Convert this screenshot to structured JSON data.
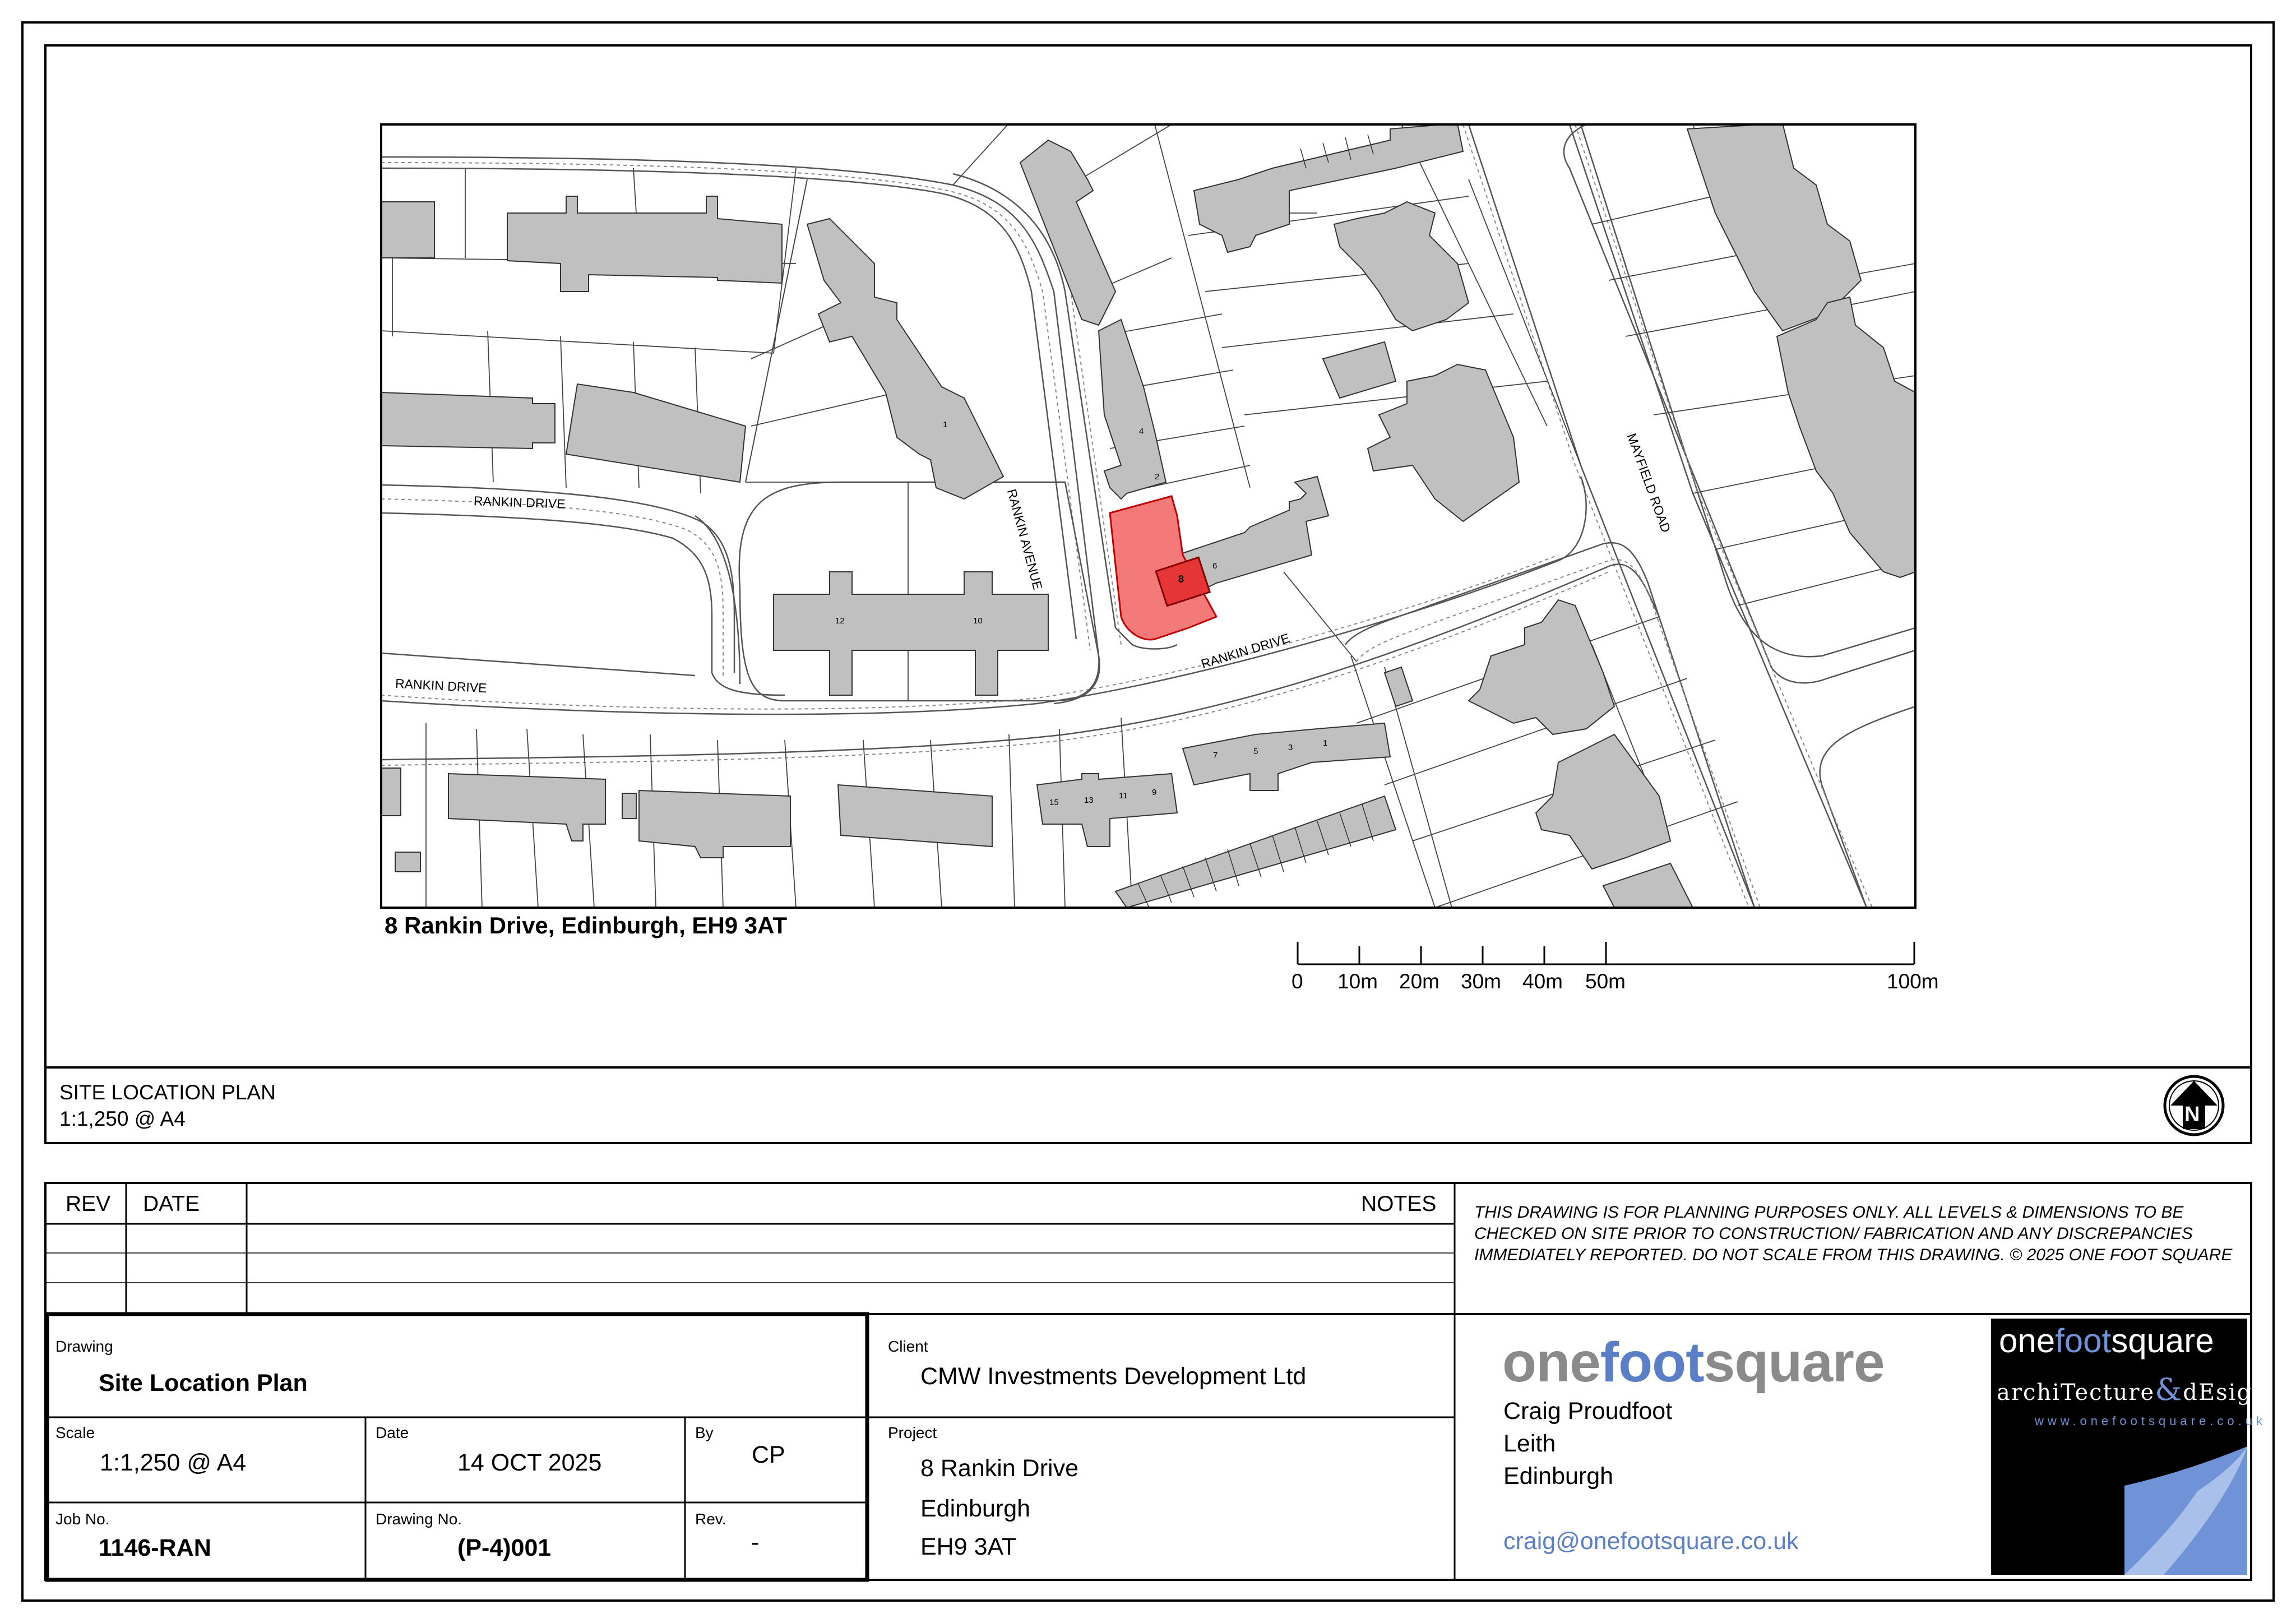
{
  "map": {
    "street_labels": [
      "RANKIN DRIVE",
      "RANKIN DRIVE",
      "RANKIN DRIVE",
      "RANKIN AVENUE",
      "MAYFIELD ROAD"
    ],
    "house_numbers": [
      "1",
      "2",
      "4",
      "6",
      "8",
      "10",
      "12",
      "15",
      "13",
      "11",
      "9",
      "7",
      "5",
      "3",
      "1"
    ],
    "site_color": "#f47a7a",
    "site_building_color": "#e53535",
    "building_color": "#c0c0c0"
  },
  "address_caption": "8 Rankin Drive, Edinburgh, EH9 3AT",
  "scale_bar": {
    "labels": [
      "0",
      "10m",
      "20m",
      "30m",
      "40m",
      "50m",
      "100m"
    ]
  },
  "plan_title": {
    "name": "SITE LOCATION PLAN",
    "scale": "1:1,250 @ A4"
  },
  "north_arrow": {
    "letter": "N"
  },
  "revisions": {
    "headers": {
      "rev": "REV",
      "date": "DATE",
      "notes": "NOTES"
    },
    "disclaimer": "THIS DRAWING IS FOR PLANNING PURPOSES ONLY. ALL LEVELS & DIMENSIONS TO BE CHECKED ON SITE PRIOR TO CONSTRUCTION/ FABRICATION AND ANY DISCREPANCIES IMMEDIATELY REPORTED. DO NOT SCALE FROM THIS DRAWING. © 2025 ONE FOOT SQUARE"
  },
  "title_block": {
    "drawing_label": "Drawing",
    "drawing_value": "Site Location Plan",
    "scale_label": "Scale",
    "scale_value": "1:1,250 @ A4",
    "date_label": "Date",
    "date_value": "14 OCT 2025",
    "by_label": "By",
    "by_value": "CP",
    "job_label": "Job No.",
    "job_value": "1146-RAN",
    "drawing_no_label": "Drawing No.",
    "drawing_no_value": "(P-4)001",
    "rev_label": "Rev.",
    "rev_value": "-",
    "client_label": "Client",
    "client_value": "CMW Investments Development Ltd",
    "project_label": "Project",
    "project_lines": [
      "8 Rankin Drive",
      "Edinburgh",
      "EH9 3AT"
    ]
  },
  "company": {
    "logo_part1": "one",
    "logo_part2": "foot",
    "logo_part3": "square",
    "address_lines": [
      "Craig Proudfoot",
      "Leith",
      "Edinburgh"
    ],
    "email": "craig@onefootsquare.co.uk",
    "badge_line1_a": "one",
    "badge_line1_b": "foot",
    "badge_line1_c": "square",
    "badge_line2_a": "archiTecture",
    "badge_line2_b": "&",
    "badge_line2_c": "dEsign",
    "badge_url": "www.onefootsquare.co.uk",
    "logo_grey": "#8a8a8a",
    "logo_blue": "#5b7fc6"
  }
}
